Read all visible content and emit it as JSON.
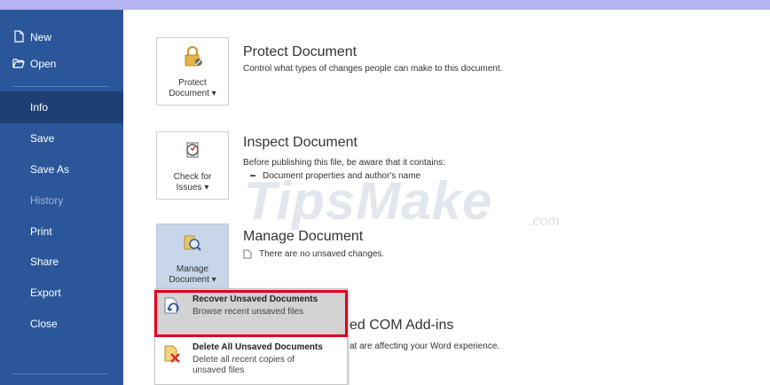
{
  "sidebar": {
    "items": [
      {
        "label": "New"
      },
      {
        "label": "Open"
      },
      {
        "label": "Info"
      },
      {
        "label": "Save"
      },
      {
        "label": "Save As"
      },
      {
        "label": "History"
      },
      {
        "label": "Print"
      },
      {
        "label": "Share"
      },
      {
        "label": "Export"
      },
      {
        "label": "Close"
      }
    ]
  },
  "protect": {
    "button_line1": "Protect",
    "button_line2": "Document ▾",
    "title": "Protect Document",
    "desc": "Control what types of changes people can make to this document."
  },
  "inspect": {
    "button_line1": "Check for",
    "button_line2": "Issues ▾",
    "title": "Inspect Document",
    "desc": "Before publishing this file, be aware that it contains:",
    "bullet": "Document properties and author's name"
  },
  "manage": {
    "button_line1": "Manage",
    "button_line2": "Document ▾",
    "title": "Manage Document",
    "desc": "There are no unsaved changes."
  },
  "com": {
    "title_partial": "ed COM Add-ins",
    "desc_partial": "at are affecting your Word experience."
  },
  "dropdown": {
    "recover_title": "Recover Unsaved Documents",
    "recover_sub": "Browse recent unsaved files",
    "delete_title": "Delete All Unsaved Documents",
    "delete_sub_line1": "Delete all recent copies of",
    "delete_sub_line2": "unsaved files"
  },
  "watermark": {
    "text": "TipsMake",
    "suffix": ".com"
  },
  "colors": {
    "sidebar_bg": "#2b579a",
    "sidebar_active": "#1e3f73",
    "highlight_border": "#e0001b"
  }
}
